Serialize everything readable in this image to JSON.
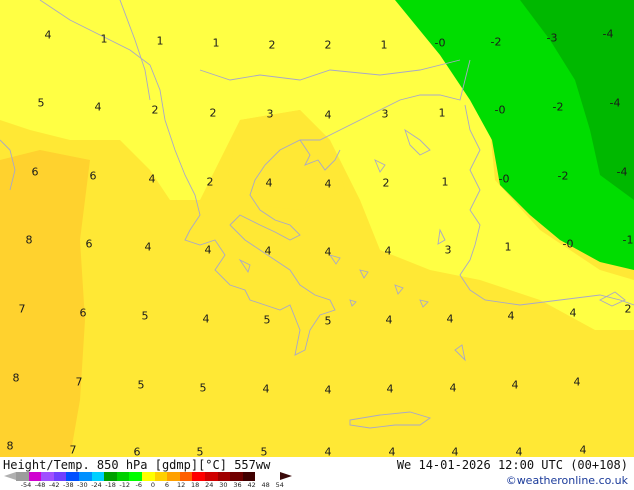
{
  "title": "Height/Temp. 850 hPa [gdmp][°C] 557ww",
  "valid_time": "We 14-01-2026 12:00 UTC (00+108)",
  "credit": "©weatheronline.co.uk",
  "colors": {
    "yellow_light": "#ffff44",
    "yellow": "#ffe835",
    "yellow_deep": "#ffd22e",
    "green": "#00dd00",
    "green_dark": "#00b800",
    "coastline": "#a8a8c8"
  },
  "colorbar": {
    "labels": [
      "-54",
      "-48",
      "-42",
      "-38",
      "-30",
      "-24",
      "-18",
      "-12",
      "-6",
      "0",
      "6",
      "12",
      "18",
      "24",
      "30",
      "36",
      "42",
      "48",
      "54"
    ],
    "colors": [
      "#9c9c9c",
      "#d000d0",
      "#a050ff",
      "#7040ff",
      "#0050ff",
      "#0090ff",
      "#00d0ff",
      "#00a000",
      "#00d000",
      "#00ff00",
      "#ffff00",
      "#ffd000",
      "#ffa000",
      "#ff6000",
      "#ff0000",
      "#d00000",
      "#a00000",
      "#700000",
      "#400000"
    ]
  },
  "temperature_labels": [
    {
      "text": "4",
      "gx": 48,
      "gy": 35
    },
    {
      "text": "1",
      "gx": 104,
      "gy": 39
    },
    {
      "text": "1",
      "gx": 160,
      "gy": 41
    },
    {
      "text": "1",
      "gx": 216,
      "gy": 43
    },
    {
      "text": "2",
      "gx": 272,
      "gy": 45
    },
    {
      "text": "2",
      "gx": 328,
      "gy": 45
    },
    {
      "text": "1",
      "gx": 384,
      "gy": 45
    },
    {
      "text": "-0",
      "gx": 440,
      "gy": 43
    },
    {
      "text": "-2",
      "gx": 496,
      "gy": 42
    },
    {
      "text": "-3",
      "gx": 552,
      "gy": 38
    },
    {
      "text": "-4",
      "gx": 608,
      "gy": 34
    },
    {
      "text": "5",
      "gx": 41,
      "gy": 103
    },
    {
      "text": "4",
      "gx": 98,
      "gy": 107
    },
    {
      "text": "2",
      "gx": 155,
      "gy": 110
    },
    {
      "text": "2",
      "gx": 213,
      "gy": 113
    },
    {
      "text": "3",
      "gx": 270,
      "gy": 114
    },
    {
      "text": "4",
      "gx": 328,
      "gy": 115
    },
    {
      "text": "3",
      "gx": 385,
      "gy": 114
    },
    {
      "text": "1",
      "gx": 442,
      "gy": 113
    },
    {
      "text": "-0",
      "gx": 500,
      "gy": 110
    },
    {
      "text": "-2",
      "gx": 558,
      "gy": 107
    },
    {
      "text": "-4",
      "gx": 615,
      "gy": 103
    },
    {
      "text": "6",
      "gx": 35,
      "gy": 172
    },
    {
      "text": "6",
      "gx": 93,
      "gy": 176
    },
    {
      "text": "4",
      "gx": 152,
      "gy": 179
    },
    {
      "text": "2",
      "gx": 210,
      "gy": 182
    },
    {
      "text": "4",
      "gx": 269,
      "gy": 183
    },
    {
      "text": "4",
      "gx": 328,
      "gy": 184
    },
    {
      "text": "2",
      "gx": 386,
      "gy": 183
    },
    {
      "text": "1",
      "gx": 445,
      "gy": 182
    },
    {
      "text": "-0",
      "gx": 504,
      "gy": 179
    },
    {
      "text": "-2",
      "gx": 563,
      "gy": 176
    },
    {
      "text": "-4",
      "gx": 622,
      "gy": 172
    },
    {
      "text": "8",
      "gx": 29,
      "gy": 240
    },
    {
      "text": "6",
      "gx": 89,
      "gy": 244
    },
    {
      "text": "4",
      "gx": 148,
      "gy": 247
    },
    {
      "text": "4",
      "gx": 208,
      "gy": 250
    },
    {
      "text": "4",
      "gx": 268,
      "gy": 251
    },
    {
      "text": "4",
      "gx": 328,
      "gy": 252
    },
    {
      "text": "4",
      "gx": 388,
      "gy": 251
    },
    {
      "text": "3",
      "gx": 448,
      "gy": 250
    },
    {
      "text": "1",
      "gx": 508,
      "gy": 247
    },
    {
      "text": "-0",
      "gx": 568,
      "gy": 244
    },
    {
      "text": "-1",
      "gx": 628,
      "gy": 240
    },
    {
      "text": "7",
      "gx": 22,
      "gy": 309
    },
    {
      "text": "6",
      "gx": 83,
      "gy": 313
    },
    {
      "text": "5",
      "gx": 145,
      "gy": 316
    },
    {
      "text": "4",
      "gx": 206,
      "gy": 319
    },
    {
      "text": "5",
      "gx": 267,
      "gy": 320
    },
    {
      "text": "5",
      "gx": 328,
      "gy": 321
    },
    {
      "text": "4",
      "gx": 389,
      "gy": 320
    },
    {
      "text": "4",
      "gx": 450,
      "gy": 319
    },
    {
      "text": "4",
      "gx": 511,
      "gy": 316
    },
    {
      "text": "4",
      "gx": 573,
      "gy": 313
    },
    {
      "text": "2",
      "gx": 634,
      "gy": 309
    },
    {
      "text": "8",
      "gx": 16,
      "gy": 378
    },
    {
      "text": "7",
      "gx": 79,
      "gy": 382
    },
    {
      "text": "5",
      "gx": 141,
      "gy": 385
    },
    {
      "text": "5",
      "gx": 203,
      "gy": 388
    },
    {
      "text": "4",
      "gx": 266,
      "gy": 389
    },
    {
      "text": "4",
      "gx": 328,
      "gy": 390
    },
    {
      "text": "4",
      "gx": 390,
      "gy": 389
    },
    {
      "text": "4",
      "gx": 453,
      "gy": 388
    },
    {
      "text": "4",
      "gx": 515,
      "gy": 385
    },
    {
      "text": "4",
      "gx": 577,
      "gy": 382
    },
    {
      "text": "8",
      "gx": 10,
      "gy": 446
    },
    {
      "text": "7",
      "gx": 73,
      "gy": 450
    },
    {
      "text": "6",
      "gx": 137,
      "gy": 453
    },
    {
      "text": "5",
      "gx": 200,
      "gy": 456
    },
    {
      "text": "5",
      "gx": 264,
      "gy": 457
    },
    {
      "text": "4",
      "gx": 328,
      "gy": 458
    },
    {
      "text": "4",
      "gx": 392,
      "gy": 457
    },
    {
      "text": "4",
      "gx": 455,
      "gy": 456
    },
    {
      "text": "4",
      "gx": 519,
      "gy": 453
    },
    {
      "text": "4",
      "gx": 583,
      "gy": 450
    }
  ]
}
